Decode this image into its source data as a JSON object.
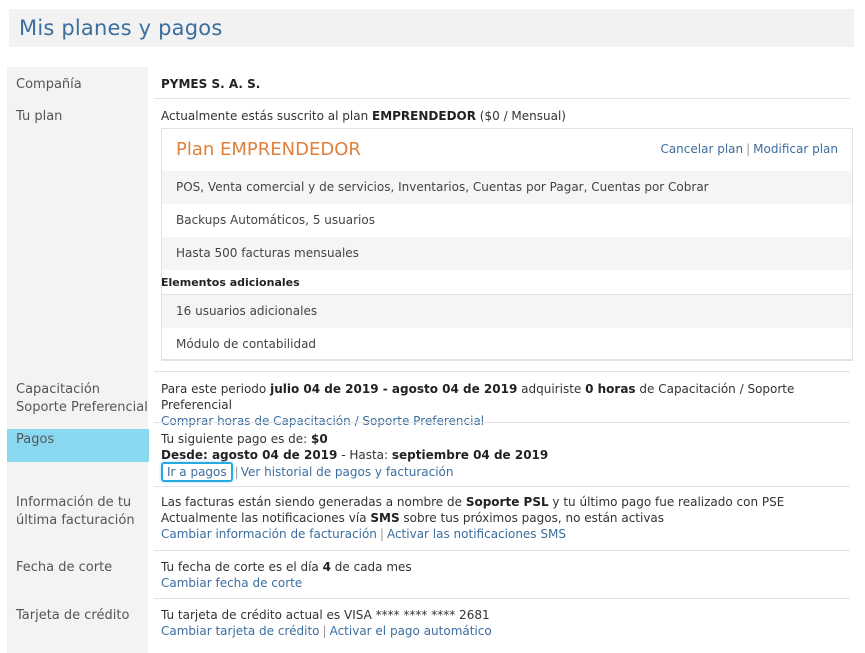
{
  "page": {
    "title": "Mis planes y pagos"
  },
  "company": {
    "label": "Compañía",
    "value": "PYMES S. A. S."
  },
  "plan": {
    "label": "Tu plan",
    "line_prefix": "Actualmente estás suscrito al plan ",
    "line_plan": "EMPRENDEDOR",
    "line_suffix": " ($0 / Mensual)",
    "card_title": "Plan EMPRENDEDOR",
    "cancel_label": "Cancelar plan",
    "modify_label": "Modificar plan",
    "features": [
      "POS, Venta comercial y de servicios, Inventarios, Cuentas por Pagar, Cuentas por Cobrar",
      "Backups Automáticos, 5 usuarios",
      "Hasta 500 facturas mensuales"
    ],
    "extras_title": "Elementos adicionales",
    "extras": [
      "16 usuarios adicionales",
      "Módulo de contabilidad"
    ]
  },
  "training": {
    "label": "Capacitación Soporte Preferencial",
    "t1": "Para este periodo ",
    "period": "julio 04 de 2019 - agosto 04 de 2019",
    "t2": " adquiriste ",
    "hours": "0 horas",
    "t3": " de Capacitación / Soporte Preferencial",
    "buy_link": "Comprar horas de Capacitación / Soporte Preferencial"
  },
  "payments": {
    "label": "Pagos",
    "next_prefix": "Tu siguiente pago es de: ",
    "next_amount": "$0",
    "from_label": "Desde: ",
    "from_date": "agosto 04 de 2019",
    "to_label": " - Hasta: ",
    "to_date": "septiembre 04 de 2019",
    "go_link": "Ir a pagos",
    "history_link": "Ver historial de pagos y facturación"
  },
  "billing": {
    "label": "Información de tu última facturación",
    "l1a": "Las facturas están siendo generadas a nombre de ",
    "l1b": "Soporte PSL",
    "l1c": " y tu último pago fue realizado con PSE",
    "l2a": "Actualmente las notificaciones vía ",
    "l2b": "SMS",
    "l2c": " sobre tus próximos pagos, no están activas",
    "change_link": "Cambiar información de facturación",
    "sms_link": "Activar las notificaciones SMS"
  },
  "cutoff": {
    "label": "Fecha de corte",
    "a": "Tu fecha de corte es el día ",
    "day": "4",
    "b": " de cada mes",
    "change_link": "Cambiar fecha de corte"
  },
  "card": {
    "label": "Tarjeta de crédito",
    "text": "Tu tarjeta de crédito actual es VISA **** **** **** 2681",
    "change_link": "Cambiar tarjeta de crédito",
    "auto_link": "Activar el pago automático"
  }
}
